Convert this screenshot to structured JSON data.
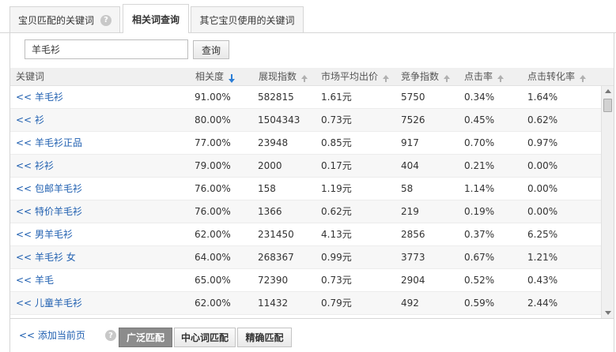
{
  "tabs": [
    {
      "label": "宝贝匹配的关键词",
      "active": false,
      "has_help": true
    },
    {
      "label": "相关词查询",
      "active": true,
      "has_help": false
    },
    {
      "label": "其它宝贝使用的关键词",
      "active": false,
      "has_help": false
    }
  ],
  "search": {
    "value": "羊毛衫",
    "button_label": "查询"
  },
  "columns": [
    {
      "label": "关键词",
      "sort": "none"
    },
    {
      "label": "相关度",
      "sort": "desc"
    },
    {
      "label": "展现指数",
      "sort": "up"
    },
    {
      "label": "市场平均出价",
      "sort": "up"
    },
    {
      "label": "竞争指数",
      "sort": "up"
    },
    {
      "label": "点击率",
      "sort": "up"
    },
    {
      "label": "点击转化率",
      "sort": "up"
    }
  ],
  "add_prefix": "<< ",
  "rows": [
    {
      "keyword": "羊毛衫",
      "relevance": "91.00%",
      "impressions": "582815",
      "avg_bid": "1.61元",
      "competition": "5750",
      "ctr": "0.34%",
      "cvr": "1.64%"
    },
    {
      "keyword": "衫",
      "relevance": "80.00%",
      "impressions": "1504343",
      "avg_bid": "0.73元",
      "competition": "7526",
      "ctr": "0.45%",
      "cvr": "0.62%"
    },
    {
      "keyword": "羊毛衫正品",
      "relevance": "77.00%",
      "impressions": "23948",
      "avg_bid": "0.85元",
      "competition": "917",
      "ctr": "0.70%",
      "cvr": "0.97%"
    },
    {
      "keyword": "衫衫",
      "relevance": "79.00%",
      "impressions": "2000",
      "avg_bid": "0.17元",
      "competition": "404",
      "ctr": "0.21%",
      "cvr": "0.00%"
    },
    {
      "keyword": "包邮羊毛衫",
      "relevance": "76.00%",
      "impressions": "158",
      "avg_bid": "1.19元",
      "competition": "58",
      "ctr": "1.14%",
      "cvr": "0.00%"
    },
    {
      "keyword": "特价羊毛衫",
      "relevance": "76.00%",
      "impressions": "1366",
      "avg_bid": "0.62元",
      "competition": "219",
      "ctr": "0.19%",
      "cvr": "0.00%"
    },
    {
      "keyword": "男羊毛衫",
      "relevance": "62.00%",
      "impressions": "231450",
      "avg_bid": "4.13元",
      "competition": "2856",
      "ctr": "0.37%",
      "cvr": "6.25%"
    },
    {
      "keyword": "羊毛衫 女",
      "relevance": "64.00%",
      "impressions": "268367",
      "avg_bid": "0.99元",
      "competition": "3773",
      "ctr": "0.67%",
      "cvr": "1.21%"
    },
    {
      "keyword": "羊毛",
      "relevance": "65.00%",
      "impressions": "72390",
      "avg_bid": "0.73元",
      "competition": "2904",
      "ctr": "0.52%",
      "cvr": "0.43%"
    },
    {
      "keyword": "儿童羊毛衫",
      "relevance": "62.00%",
      "impressions": "11432",
      "avg_bid": "0.79元",
      "competition": "492",
      "ctr": "0.59%",
      "cvr": "2.44%"
    }
  ],
  "footer": {
    "add_page_label": "<< 添加当前页",
    "match_buttons": [
      {
        "label": "广泛匹配",
        "active": true
      },
      {
        "label": "中心词匹配",
        "active": false
      },
      {
        "label": "精确匹配",
        "active": false
      }
    ]
  },
  "colors": {
    "link": "#1f5fb0",
    "sort_active": "#2b7dd6",
    "active_match_bg": "#8c8c8c"
  }
}
